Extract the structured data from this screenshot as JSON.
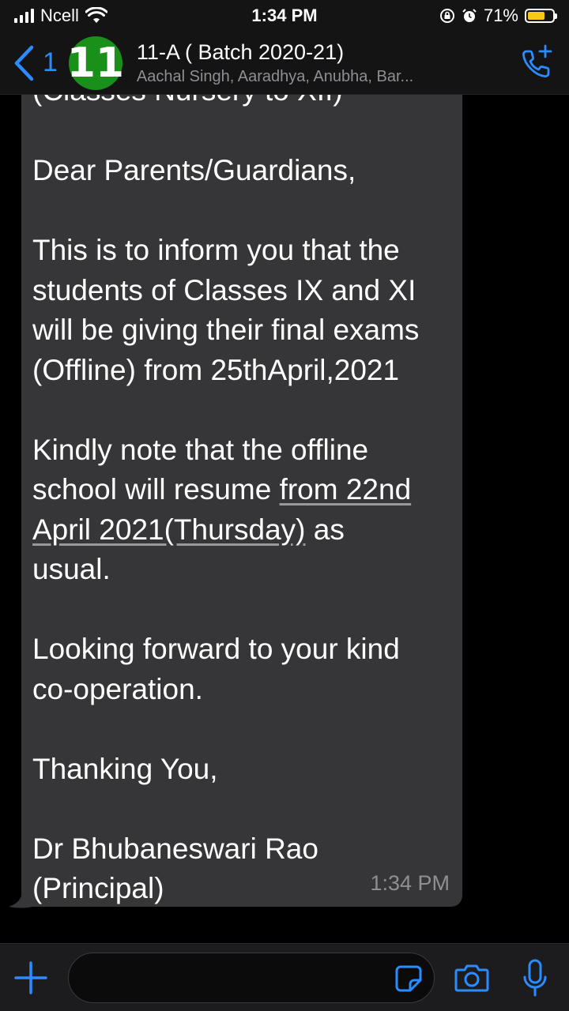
{
  "status_bar": {
    "carrier": "Ncell",
    "time": "1:34 PM",
    "battery": "71%",
    "battery_level": 0.71,
    "icons": [
      "signal-icon",
      "wifi-icon",
      "orientation-lock-icon",
      "alarm-icon",
      "battery-icon"
    ]
  },
  "header": {
    "back_count": "1",
    "avatar_text": "11",
    "avatar_color": "#1a8f1a",
    "title": "11-A ( Batch 2020-21)",
    "subtitle": "Aachal Singh, Aaradhya, Anubha, Bar...",
    "accent_color": "#2a8cff"
  },
  "message": {
    "clipped_top": "(Classes Nursery to XII)",
    "greeting": "Dear Parents/Guardians,",
    "para1": [
      "This is to inform you that the",
      "students of  Classes IX and XI",
      "will be giving their final exams",
      "(Offline) from 25thApril,2021"
    ],
    "para2_line1": "Kindly note that the offline",
    "para2_line2_plain": "school will resume ",
    "para2_line2_link": "from 22nd",
    "para2_line3_link": "April 2021(Thursday)",
    "para2_line3_plain": " as",
    "para2_line4": "usual.",
    "para3": [
      "Looking forward to your kind",
      "co-operation."
    ],
    "closing": "Thanking You,",
    "signature_name": "Dr Bhubaneswari Rao",
    "signature_title": "(Principal)",
    "time": "1:34 PM",
    "bubble_color": "#363638"
  },
  "input_bar": {
    "value": "",
    "icons": [
      "plus-icon",
      "sticker-icon",
      "camera-icon",
      "microphone-icon"
    ]
  }
}
